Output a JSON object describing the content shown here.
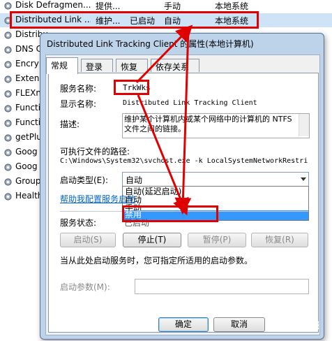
{
  "services": [
    {
      "name": "Disk Defragmen...",
      "desc": "提供...",
      "status": "",
      "startup": "手动",
      "logon": "本地系统"
    },
    {
      "name": "Distributed Link ...",
      "desc": "维护...",
      "status": "已启动",
      "startup": "自动",
      "logon": "本地系统"
    },
    {
      "name": "Distribu",
      "desc": "",
      "status": "",
      "startup": "",
      "logon": ""
    },
    {
      "name": "DNS C",
      "desc": "",
      "status": "",
      "startup": "",
      "logon": ""
    },
    {
      "name": "Encryp",
      "desc": "",
      "status": "",
      "startup": "",
      "logon": ""
    },
    {
      "name": "Extens",
      "desc": "",
      "status": "",
      "startup": "",
      "logon": ""
    },
    {
      "name": "FLEXn",
      "desc": "",
      "status": "",
      "startup": "",
      "logon": ""
    },
    {
      "name": "Functi",
      "desc": "",
      "status": "",
      "startup": "",
      "logon": ""
    },
    {
      "name": "Functi",
      "desc": "",
      "status": "",
      "startup": "",
      "logon": ""
    },
    {
      "name": "getPlu",
      "desc": "",
      "status": "",
      "startup": "",
      "logon": ""
    },
    {
      "name": "Goog",
      "desc": "",
      "status": "",
      "startup": "",
      "logon": ""
    },
    {
      "name": "Goog",
      "desc": "",
      "status": "",
      "startup": "",
      "logon": ""
    },
    {
      "name": "Group",
      "desc": "",
      "status": "",
      "startup": "",
      "logon": ""
    },
    {
      "name": "Health",
      "desc": "",
      "status": "",
      "startup": "",
      "logon": ""
    }
  ],
  "dialog": {
    "title": "Distributed Link Tracking Client 的属性(本地计算机)",
    "tabs": [
      "常规",
      "登录",
      "恢复",
      "依存关系"
    ],
    "service_name_label": "服务名称:",
    "service_name": "TrkWks",
    "display_name_label": "显示名称:",
    "display_name": "Distributed Link Tracking Client",
    "description_label": "描述:",
    "description": "维护某个计算机内或某个网络中的计算机的 NTFS 文件之间的链接。",
    "exe_path_label": "可执行文件的路径:",
    "exe_path": "C:\\Windows\\System32\\svchost.exe -k LocalSystemNetworkRestric",
    "startup_type_label": "启动类型(E):",
    "startup_type_value": "自动",
    "startup_options": [
      "自动(延迟启动)",
      "自动",
      "手动",
      "禁用"
    ],
    "help_link": "帮助我配置服务启动",
    "status_label": "服务状态:",
    "status_value": "已启动",
    "btn_start": "启动(S)",
    "btn_stop": "停止(T)",
    "btn_pause": "暂停(P)",
    "btn_resume": "恢复(R)",
    "hint": "当从此处启动服务时，您可指定所适用的启动参数。",
    "params_label": "启动参数(M):",
    "btn_ok": "确定",
    "btn_cancel": "取消"
  },
  "watermark": "中关村在线",
  "annotation_color": "#e00000"
}
